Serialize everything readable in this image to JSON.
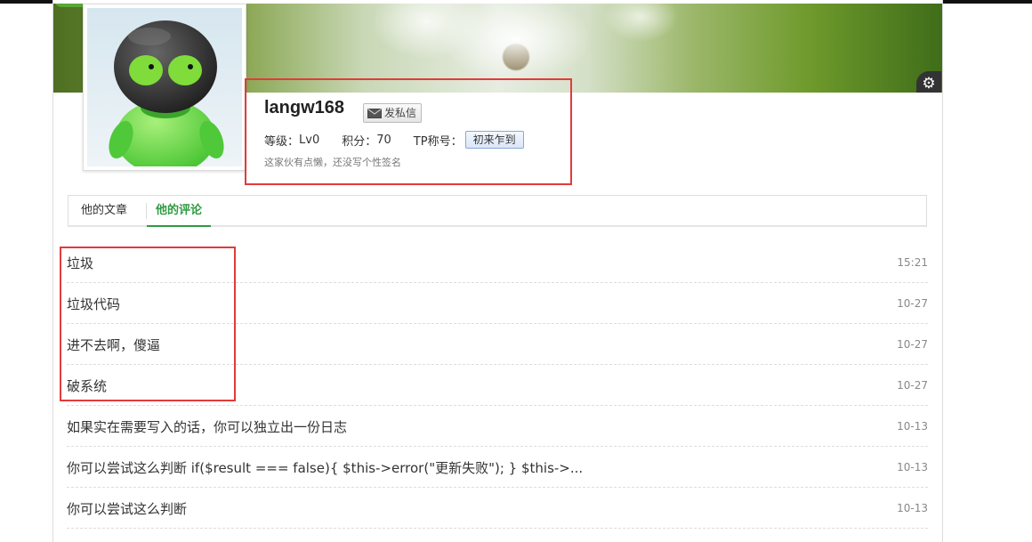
{
  "profile": {
    "username": "langw168",
    "message_button": "发私信",
    "level_label": "等级：",
    "level_value": "Lv0",
    "points_label": "积分：",
    "points_value": "70",
    "tp_label": "TP称号：",
    "tp_badge": "初来乍到",
    "signature": "这家伙有点懒，还没写个性签名"
  },
  "tabs": [
    {
      "label": "他的文章",
      "active": false
    },
    {
      "label": "他的评论",
      "active": true
    }
  ],
  "comments": [
    {
      "text": "垃圾",
      "time": "15:21"
    },
    {
      "text": "垃圾代码",
      "time": "10-27"
    },
    {
      "text": "进不去啊，傻逼",
      "time": "10-27"
    },
    {
      "text": "破系统",
      "time": "10-27"
    },
    {
      "text": "如果实在需要写入的话，你可以独立出一份日志",
      "time": "10-13"
    },
    {
      "text": "你可以尝试这么判断 if($result === false){ $this->error(\"更新失败\"); } $this->...",
      "time": "10-13"
    },
    {
      "text": "你可以尝试这么判断",
      "time": "10-13"
    }
  ],
  "icons": {
    "settings": "gear-icon",
    "mail": "mail-icon"
  },
  "colors": {
    "accent": "#2e9b41",
    "annotation": "#e23b3b"
  }
}
